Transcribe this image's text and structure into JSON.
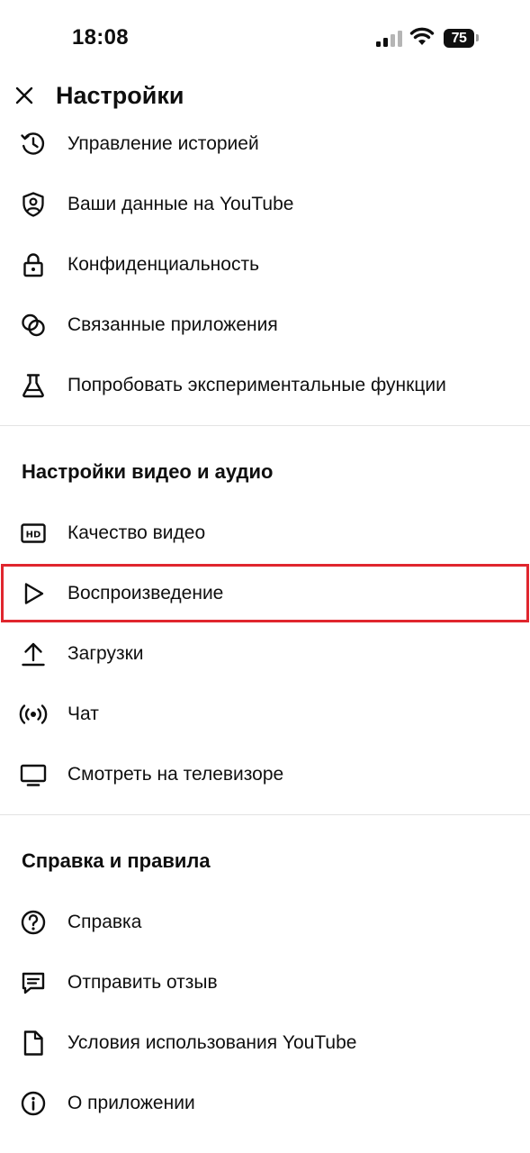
{
  "status_bar": {
    "time": "18:08",
    "battery": "75"
  },
  "header": {
    "title": "Настройки"
  },
  "sections": {
    "account": {
      "items": [
        {
          "label": "Управление историей",
          "icon": "history-icon"
        },
        {
          "label": "Ваши данные на YouTube",
          "icon": "shield-person-icon"
        },
        {
          "label": "Конфиденциальность",
          "icon": "lock-icon"
        },
        {
          "label": "Связанные приложения",
          "icon": "linked-circles-icon"
        },
        {
          "label": "Попробовать экспериментальные функции",
          "icon": "flask-icon"
        }
      ]
    },
    "video_audio": {
      "title": "Настройки видео и аудио",
      "items": [
        {
          "label": "Качество видео",
          "icon": "hd-icon"
        },
        {
          "label": "Воспроизведение",
          "icon": "play-icon"
        },
        {
          "label": "Загрузки",
          "icon": "upload-icon"
        },
        {
          "label": "Чат",
          "icon": "broadcast-icon"
        },
        {
          "label": "Смотреть на телевизоре",
          "icon": "tv-icon"
        }
      ]
    },
    "help": {
      "title": "Справка и правила",
      "items": [
        {
          "label": "Справка",
          "icon": "help-circle-icon"
        },
        {
          "label": "Отправить отзыв",
          "icon": "feedback-icon"
        },
        {
          "label": "Условия использования YouTube",
          "icon": "document-icon"
        },
        {
          "label": "О приложении",
          "icon": "info-icon"
        }
      ]
    }
  },
  "colors": {
    "highlight": "#e0262e",
    "text": "#0f0f0f",
    "divider": "#e3e3e3"
  }
}
